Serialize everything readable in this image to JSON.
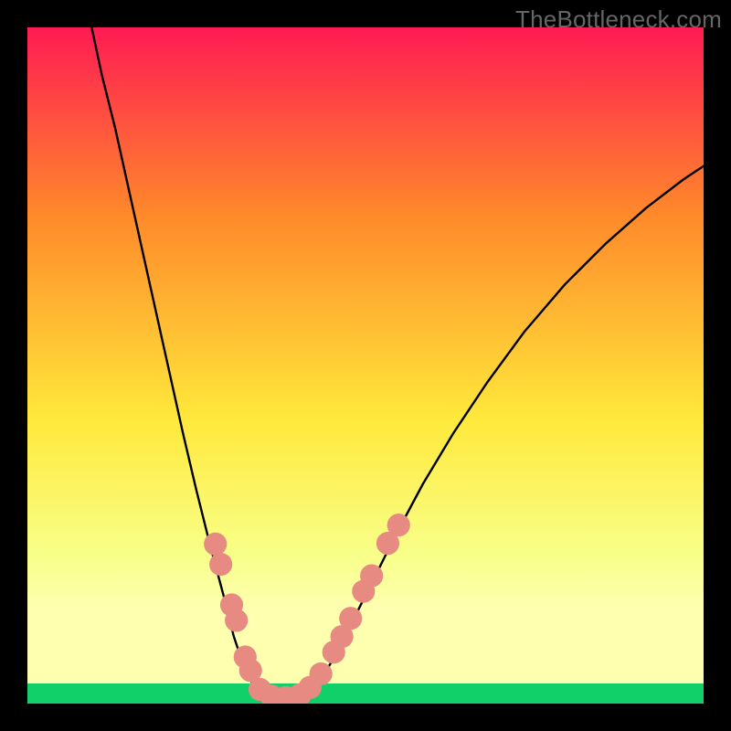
{
  "watermark": "TheBottleneck.com",
  "chart_data": {
    "type": "line",
    "title": "",
    "xlabel": "",
    "ylabel": "",
    "xlim": [
      0,
      1
    ],
    "ylim": [
      0,
      1
    ],
    "background_gradient": {
      "top": "#FF1B54",
      "mid_upper": "#FF8A2A",
      "mid": "#FFE93B",
      "lower": "#F8FF89",
      "band": "#FFFFB0",
      "bottom": "#11D06A"
    },
    "series": [
      {
        "name": "left-branch",
        "stroke": "#000000",
        "points": [
          {
            "x": 0.095,
            "y": 1.0
          },
          {
            "x": 0.11,
            "y": 0.93
          },
          {
            "x": 0.13,
            "y": 0.85
          },
          {
            "x": 0.15,
            "y": 0.76
          },
          {
            "x": 0.17,
            "y": 0.67
          },
          {
            "x": 0.19,
            "y": 0.58
          },
          {
            "x": 0.21,
            "y": 0.49
          },
          {
            "x": 0.23,
            "y": 0.4
          },
          {
            "x": 0.25,
            "y": 0.315
          },
          {
            "x": 0.27,
            "y": 0.235
          },
          {
            "x": 0.29,
            "y": 0.16
          },
          {
            "x": 0.305,
            "y": 0.1
          },
          {
            "x": 0.32,
            "y": 0.055
          },
          {
            "x": 0.335,
            "y": 0.025
          },
          {
            "x": 0.35,
            "y": 0.01
          }
        ]
      },
      {
        "name": "valley-floor",
        "stroke": "#000000",
        "points": [
          {
            "x": 0.35,
            "y": 0.01
          },
          {
            "x": 0.37,
            "y": 0.006
          },
          {
            "x": 0.39,
            "y": 0.006
          },
          {
            "x": 0.41,
            "y": 0.01
          }
        ]
      },
      {
        "name": "right-branch",
        "stroke": "#000000",
        "points": [
          {
            "x": 0.41,
            "y": 0.01
          },
          {
            "x": 0.43,
            "y": 0.03
          },
          {
            "x": 0.455,
            "y": 0.07
          },
          {
            "x": 0.48,
            "y": 0.12
          },
          {
            "x": 0.51,
            "y": 0.18
          },
          {
            "x": 0.545,
            "y": 0.25
          },
          {
            "x": 0.585,
            "y": 0.325
          },
          {
            "x": 0.63,
            "y": 0.4
          },
          {
            "x": 0.68,
            "y": 0.475
          },
          {
            "x": 0.735,
            "y": 0.55
          },
          {
            "x": 0.795,
            "y": 0.62
          },
          {
            "x": 0.855,
            "y": 0.68
          },
          {
            "x": 0.915,
            "y": 0.733
          },
          {
            "x": 0.97,
            "y": 0.775
          },
          {
            "x": 1.0,
            "y": 0.795
          }
        ]
      }
    ],
    "markers": {
      "name": "coral-dots",
      "fill": "#E78A82",
      "radius_norm": 0.017,
      "points": [
        {
          "x": 0.278,
          "y": 0.236
        },
        {
          "x": 0.286,
          "y": 0.206
        },
        {
          "x": 0.302,
          "y": 0.146
        },
        {
          "x": 0.309,
          "y": 0.123
        },
        {
          "x": 0.322,
          "y": 0.069
        },
        {
          "x": 0.33,
          "y": 0.049
        },
        {
          "x": 0.344,
          "y": 0.021
        },
        {
          "x": 0.361,
          "y": 0.011
        },
        {
          "x": 0.382,
          "y": 0.009
        },
        {
          "x": 0.403,
          "y": 0.013
        },
        {
          "x": 0.418,
          "y": 0.024
        },
        {
          "x": 0.434,
          "y": 0.044
        },
        {
          "x": 0.453,
          "y": 0.076
        },
        {
          "x": 0.465,
          "y": 0.099
        },
        {
          "x": 0.478,
          "y": 0.126
        },
        {
          "x": 0.497,
          "y": 0.166
        },
        {
          "x": 0.509,
          "y": 0.189
        },
        {
          "x": 0.533,
          "y": 0.237
        },
        {
          "x": 0.549,
          "y": 0.264
        }
      ]
    }
  }
}
